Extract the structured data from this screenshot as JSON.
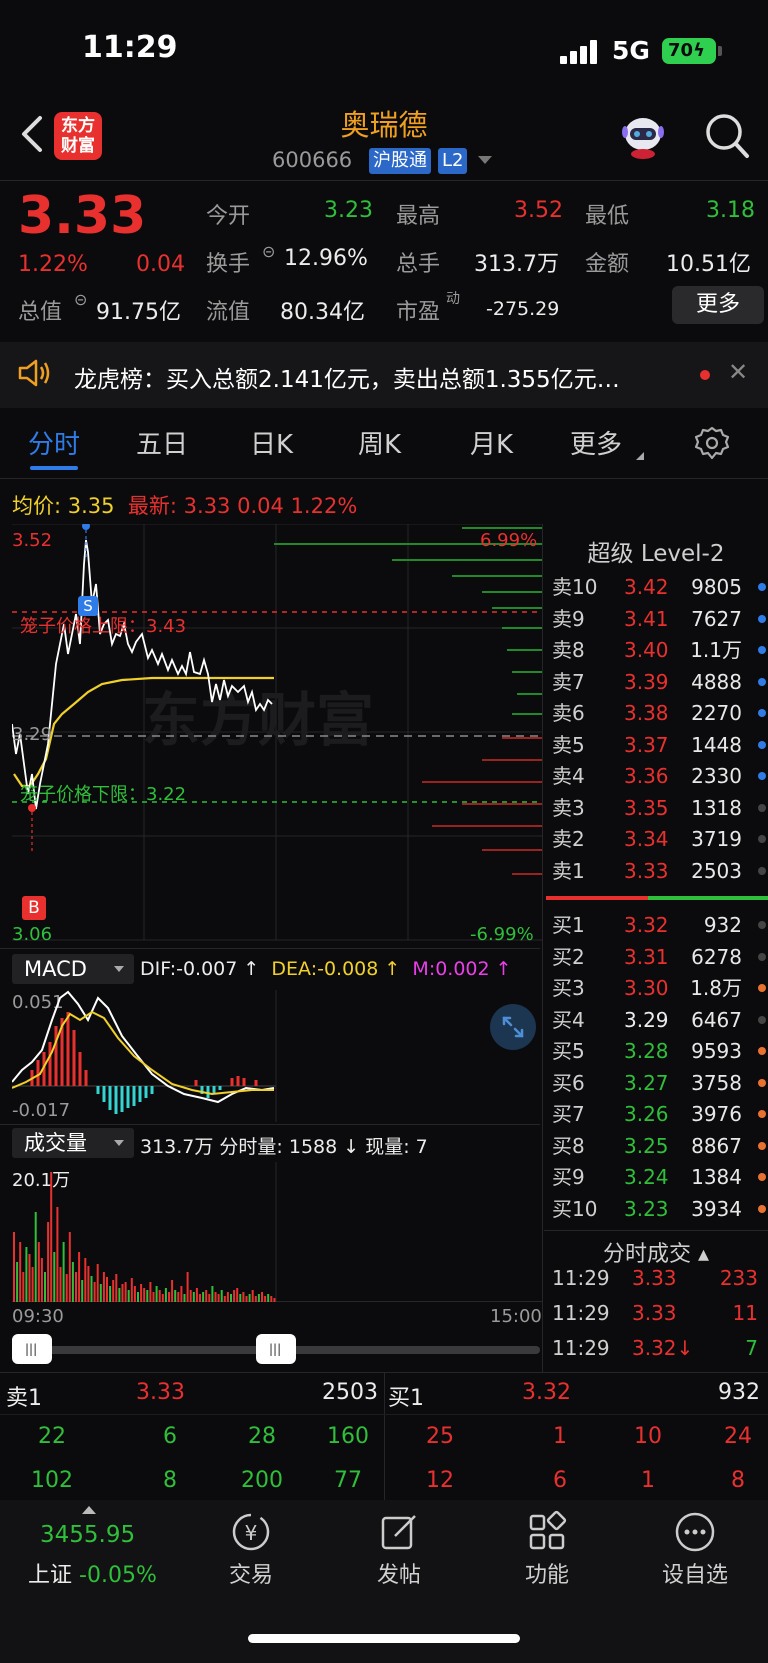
{
  "status": {
    "time": "11:29",
    "network": "5G",
    "battery": "70"
  },
  "header": {
    "logo": "东方财富",
    "name": "奥瑞德",
    "code": "600666",
    "tag1": "沪股通",
    "tag2": "L2"
  },
  "quote": {
    "price": "3.33",
    "pct": "1.22%",
    "chg": "0.04",
    "open_lbl": "今开",
    "open": "3.23",
    "high_lbl": "最高",
    "high": "3.52",
    "low_lbl": "最低",
    "low": "3.18",
    "turnover_lbl": "换手",
    "turnover": "12.96%",
    "vol_lbl": "总手",
    "vol": "313.7万",
    "amount_lbl": "金额",
    "amount": "10.51亿",
    "mcap_lbl": "总值",
    "mcap": "91.75亿",
    "float_lbl": "流值",
    "float": "80.34亿",
    "pe_lbl": "市盈",
    "pe_sup": "动",
    "pe": "-275.29",
    "more": "更多"
  },
  "news": {
    "text": "龙虎榜：买入总额2.141亿元，卖出总额1.355亿元…"
  },
  "tabs": [
    "分时",
    "五日",
    "日K",
    "周K",
    "月K",
    "更多"
  ],
  "intraday": {
    "avg_label": "均价:",
    "avg": "3.35",
    "last_label": "最新:",
    "last": "3.33",
    "last_chg": "0.04",
    "last_pct": "1.22%",
    "y_top": "3.52",
    "y_bottom": "3.06",
    "y_mid": "3.29",
    "pct_top": "6.99%",
    "pct_bottom": "-6.99%",
    "upper_limit": "笼子价格上限：3.43",
    "lower_limit": "笼子价格下限：3.22",
    "marker_s": "S",
    "marker_b": "B",
    "watermark": "东方财富",
    "time_start": "09:30",
    "time_end": "15:00"
  },
  "macd": {
    "label": "MACD",
    "dif": "DIF:-0.007 ↑",
    "dea": "DEA:-0.008 ↑",
    "m": "M:0.002 ↑",
    "top": "0.051",
    "bottom": "-0.017"
  },
  "volume": {
    "label": "成交量",
    "info": "313.7万 分时量: 1588 ↓ 现量: 7",
    "top": "20.1万"
  },
  "level2": {
    "title": "超级 Level-2",
    "asks": [
      {
        "lbl": "卖10",
        "px": "3.42",
        "vol": "9805",
        "dot": "#2f7be8"
      },
      {
        "lbl": "卖9",
        "px": "3.41",
        "vol": "7627",
        "dot": "#2f7be8"
      },
      {
        "lbl": "卖8",
        "px": "3.40",
        "vol": "1.1万",
        "dot": "#2f7be8"
      },
      {
        "lbl": "卖7",
        "px": "3.39",
        "vol": "4888",
        "dot": "#2f7be8"
      },
      {
        "lbl": "卖6",
        "px": "3.38",
        "vol": "2270",
        "dot": "#2f7be8"
      },
      {
        "lbl": "卖5",
        "px": "3.37",
        "vol": "1448",
        "dot": "#2f7be8"
      },
      {
        "lbl": "卖4",
        "px": "3.36",
        "vol": "2330",
        "dot": "#2f7be8"
      },
      {
        "lbl": "卖3",
        "px": "3.35",
        "vol": "1318",
        "dot": "#444"
      },
      {
        "lbl": "卖2",
        "px": "3.34",
        "vol": "3719",
        "dot": "#444"
      },
      {
        "lbl": "卖1",
        "px": "3.33",
        "vol": "2503",
        "dot": "#444"
      }
    ],
    "bids": [
      {
        "lbl": "买1",
        "px": "3.32",
        "vol": "932",
        "dot": "#444"
      },
      {
        "lbl": "买2",
        "px": "3.31",
        "vol": "6278",
        "dot": "#444"
      },
      {
        "lbl": "买3",
        "px": "3.30",
        "vol": "1.8万",
        "dot": "#e8712f"
      },
      {
        "lbl": "买4",
        "px": "3.29",
        "vol": "6467",
        "dot": "#444"
      },
      {
        "lbl": "买5",
        "px": "3.28",
        "vol": "9593",
        "dot": "#e8712f"
      },
      {
        "lbl": "买6",
        "px": "3.27",
        "vol": "3758",
        "dot": "#e8712f"
      },
      {
        "lbl": "买7",
        "px": "3.26",
        "vol": "3976",
        "dot": "#e8712f"
      },
      {
        "lbl": "买8",
        "px": "3.25",
        "vol": "8867",
        "dot": "#e8712f"
      },
      {
        "lbl": "买9",
        "px": "3.24",
        "vol": "1384",
        "dot": "#e8712f"
      },
      {
        "lbl": "买10",
        "px": "3.23",
        "vol": "3934",
        "dot": "#e8712f"
      }
    ]
  },
  "ticks": {
    "title": "分时成交",
    "rows": [
      {
        "t": "11:29",
        "px": "3.33",
        "vol": "233"
      },
      {
        "t": "11:29",
        "px": "3.33",
        "vol": "11"
      },
      {
        "t": "11:29",
        "px": "3.32↓",
        "vol": "7"
      }
    ]
  },
  "order_strip": {
    "ask_lbl": "卖1",
    "ask_px": "3.33",
    "ask_vol": "2503",
    "bid_lbl": "买1",
    "bid_px": "3.32",
    "bid_vol": "932",
    "ask_q1": [
      "22",
      "6",
      "28",
      "160"
    ],
    "ask_q2": [
      "102",
      "8",
      "200",
      "77"
    ],
    "bid_q1": [
      "25",
      "1",
      "10",
      "24"
    ],
    "bid_q2": [
      "12",
      "6",
      "1",
      "8"
    ]
  },
  "tabbar": {
    "index_val": "3455.95",
    "index_name": "上证",
    "index_pct": "-0.05%",
    "trade": "交易",
    "post": "发帖",
    "func": "功能",
    "watch": "设自选"
  },
  "colors": {
    "up": "#e8312f",
    "down": "#2fbf3a",
    "accent": "#2f7be8",
    "avg": "#f0d02a"
  }
}
